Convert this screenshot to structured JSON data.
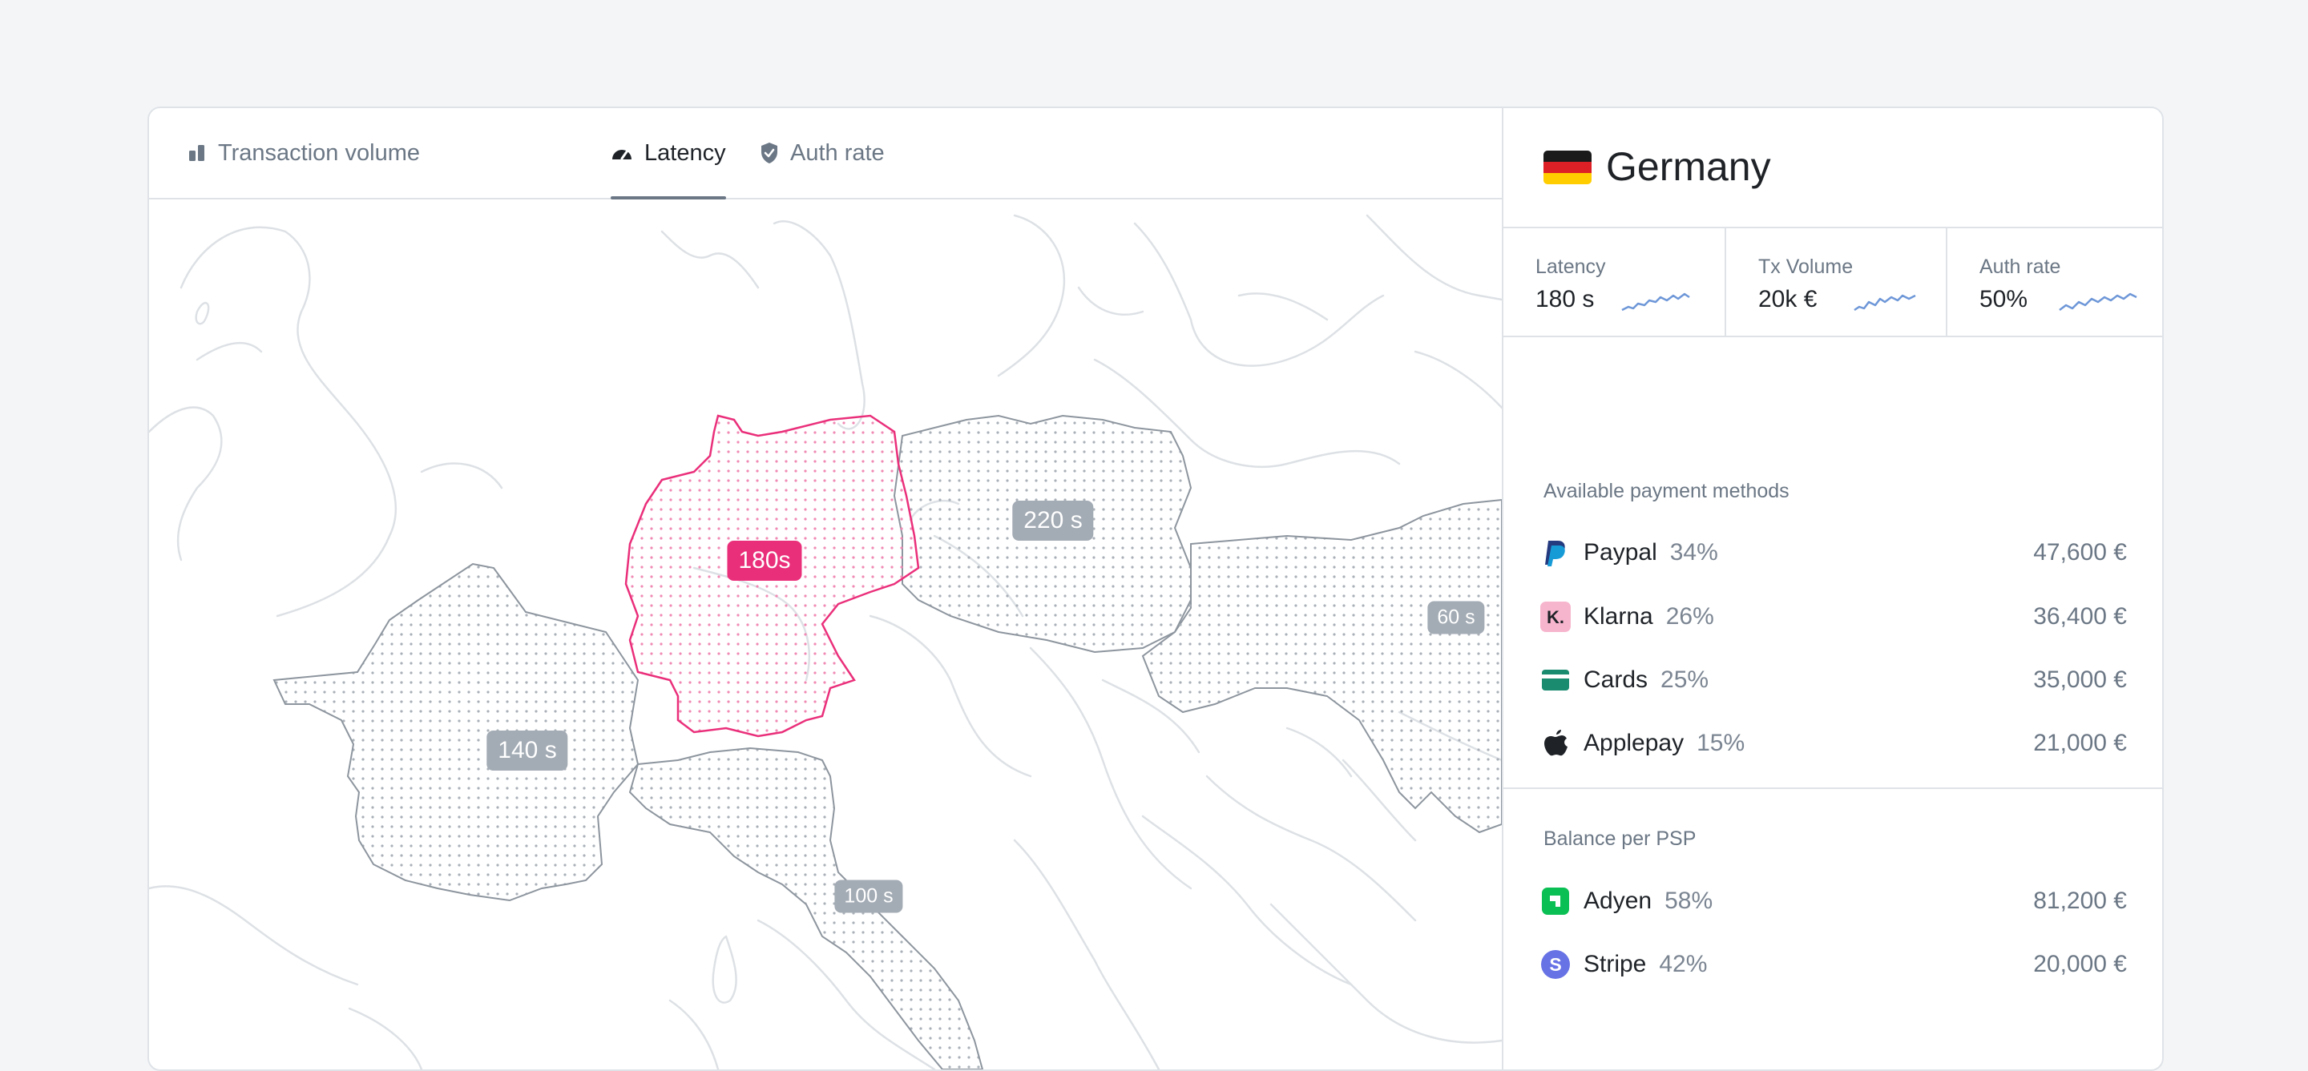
{
  "tabs": [
    {
      "label": "Transaction volume",
      "icon": "bar-chart-icon"
    },
    {
      "label": "Latency",
      "icon": "gauge-icon"
    },
    {
      "label": "Auth rate",
      "icon": "shield-check-icon"
    }
  ],
  "map": {
    "badges": [
      {
        "label": "180s",
        "selected": true
      },
      {
        "label": "220 s",
        "selected": false
      },
      {
        "label": "60 s",
        "selected": false
      },
      {
        "label": "140 s",
        "selected": false
      },
      {
        "label": "100 s",
        "selected": false
      }
    ],
    "colors": {
      "selected": "#ea2f7a",
      "badge": "#a3abb4",
      "border": "#d9dde2"
    }
  },
  "country": {
    "name": "Germany",
    "flag_colors": [
      "#1a1a1a",
      "#dd1f26",
      "#ffcd00"
    ]
  },
  "metrics": [
    {
      "label": "Latency",
      "value": "180 s"
    },
    {
      "label": "Tx Volume",
      "value": "20k €"
    },
    {
      "label": "Auth rate",
      "value": "50%"
    }
  ],
  "payment_methods": {
    "title": "Available payment methods",
    "items": [
      {
        "name": "Paypal",
        "pct": "34%",
        "amount": "47,600 €",
        "icon": "paypal-icon"
      },
      {
        "name": "Klarna",
        "pct": "26%",
        "amount": "36,400 €",
        "icon": "klarna-icon"
      },
      {
        "name": "Cards",
        "pct": "25%",
        "amount": "35,000 €",
        "icon": "card-icon"
      },
      {
        "name": "Applepay",
        "pct": "15%",
        "amount": "21,000 €",
        "icon": "apple-icon"
      }
    ]
  },
  "psp": {
    "title": "Balance per PSP",
    "items": [
      {
        "name": "Adyen",
        "pct": "58%",
        "amount": "81,200 €",
        "icon": "adyen-icon"
      },
      {
        "name": "Stripe",
        "pct": "42%",
        "amount": "20,000 €",
        "icon": "stripe-icon"
      }
    ]
  }
}
